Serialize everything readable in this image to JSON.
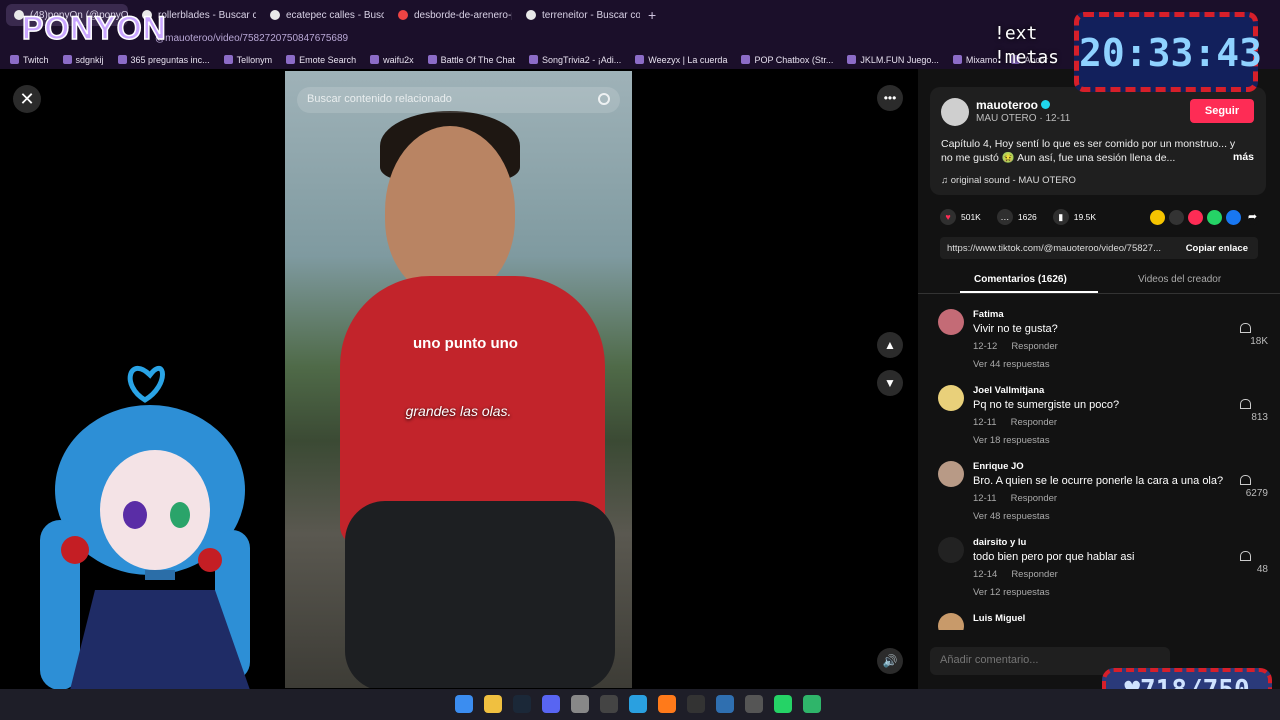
{
  "browser": {
    "tabs": [
      {
        "label": "(48)ponyOn (@ponyOn"
      },
      {
        "label": "rollerblades - Buscar con"
      },
      {
        "label": "ecatepec calles - Buscar c"
      },
      {
        "label": "desborde-de-arenero-pro"
      },
      {
        "label": "terreneitor - Buscar con G"
      }
    ],
    "url": "@mauoteroo/video/7582720750847675689",
    "bookmarks": [
      "Twitch",
      "sdgnkij",
      "365 preguntas inc...",
      "Tellonym",
      "Emote Search",
      "waifu2x",
      "Battle Of The Chat",
      "SongTrivia2 - ¡Adi...",
      "Weezyx | La cuerda",
      "POP Chatbox (Str...",
      "JKLM.FUN Juego...",
      "Mixamo",
      "Ancor"
    ]
  },
  "video": {
    "search_placeholder": "Buscar contenido relacionado",
    "caption": "grandes las olas.",
    "shirt_text": "uno punto uno"
  },
  "post": {
    "username": "mauoteroo",
    "subline": "MAU OTERO · 12-11",
    "follow_label": "Seguir",
    "description": "Capítulo 4, Hoy sentí lo que es ser comido por un monstruo... y no me gustó 🤢 Aun así, fue una sesión llena de...",
    "more_label": "más",
    "sound": "original sound - MAU OTERO",
    "likes": "501K",
    "comments_count": "1626",
    "saves": "19.5K",
    "link": "https://www.tiktok.com/@mauoteroo/video/75827...",
    "copy_label": "Copiar enlace"
  },
  "tabs": {
    "comments": "Comentarios (1626)",
    "creator_videos": "Videos del creador"
  },
  "comments": [
    {
      "name": "Fatima",
      "text": "Vivir no te gusta?",
      "date": "12-12",
      "reply": "Responder",
      "replies": "Ver 44 respuestas",
      "likes": "18K"
    },
    {
      "name": "Joel Vallmitjana",
      "text": "Pq no te sumergiste un poco?",
      "date": "12-11",
      "reply": "Responder",
      "replies": "Ver 18 respuestas",
      "likes": "813"
    },
    {
      "name": "Enrique JO",
      "text": "Bro. A quien se le ocurre ponerle la cara a una ola?",
      "date": "12-11",
      "reply": "Responder",
      "replies": "Ver 48 respuestas",
      "likes": "6279"
    },
    {
      "name": "dairsito y lu",
      "text": "todo bien pero por que hablar asi",
      "date": "12-14",
      "reply": "Responder",
      "replies": "Ver 12 respuestas",
      "likes": "48"
    },
    {
      "name": "Luis Miguel",
      "text": "",
      "date": "",
      "reply": "",
      "replies": "",
      "likes": ""
    }
  ],
  "comment_input_placeholder": "Añadir comentario...",
  "overlay": {
    "logo": "PONYON",
    "ext_text": "!ext\n!metas",
    "timer": "20:33:43",
    "counter": "♥718/750"
  },
  "colors": {
    "accent": "#fe2c55",
    "panel_bg": "#121212",
    "chrome_bg": "#1b0f2a"
  }
}
